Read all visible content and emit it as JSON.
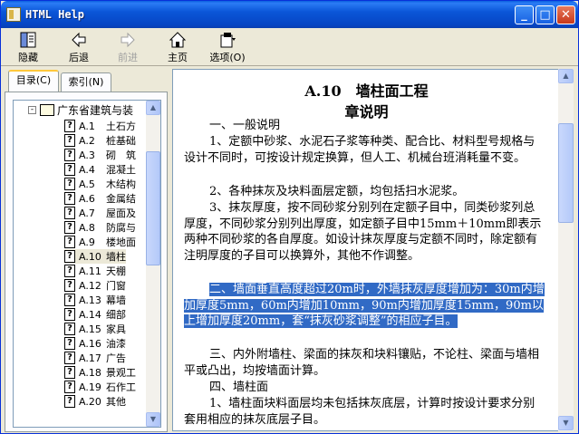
{
  "window": {
    "title": "HTML Help"
  },
  "titlebar_buttons": {
    "minimize": "_",
    "maximize": "□",
    "close": "✕"
  },
  "toolbar": {
    "hide": "隐藏",
    "back": "后退",
    "forward": "前进",
    "home": "主页",
    "options": "选项(O)"
  },
  "tabs": {
    "contents": "目录(C)",
    "index": "索引(N)"
  },
  "tree": {
    "root": "广东省建筑与装",
    "items": [
      {
        "code": "A.1",
        "label": "土石方"
      },
      {
        "code": "A.2",
        "label": "桩基础"
      },
      {
        "code": "A.3",
        "label": "砌　筑"
      },
      {
        "code": "A.4",
        "label": "混凝土"
      },
      {
        "code": "A.5",
        "label": "木结构"
      },
      {
        "code": "A.6",
        "label": "金属结"
      },
      {
        "code": "A.7",
        "label": "屋面及"
      },
      {
        "code": "A.8",
        "label": "防腐与"
      },
      {
        "code": "A.9",
        "label": "楼地面"
      },
      {
        "code": "A.10",
        "label": "墙柱"
      },
      {
        "code": "A.11",
        "label": "天棚"
      },
      {
        "code": "A.12",
        "label": "门窗"
      },
      {
        "code": "A.13",
        "label": "幕墙"
      },
      {
        "code": "A.14",
        "label": "细部"
      },
      {
        "code": "A.15",
        "label": "家具"
      },
      {
        "code": "A.16",
        "label": "油漆"
      },
      {
        "code": "A.17",
        "label": "广告"
      },
      {
        "code": "A.18",
        "label": "景观工"
      },
      {
        "code": "A.19",
        "label": "石作工"
      },
      {
        "code": "A.20",
        "label": "其他"
      }
    ]
  },
  "doc": {
    "title1": "A.10　墙柱面工程",
    "title2": "章说明",
    "p1": "一、一般说明",
    "p2": "1、定额中砂浆、水泥石子浆等种类、配合比、材料型号规格与设计不同时，可按设计规定换算，但人工、机械台班消耗量不变。",
    "p3": "2、各种抹灰及块料面层定额，均包括扫水泥浆。",
    "p4": "3、抹灰厚度，按不同砂浆分别列在定额子目中，同类砂浆列总厚度，不同砂浆分别列出厚度，如定额子目中15mm＋10mm即表示两种不同砂浆的各自厚度。如设计抹灰厚度与定额不同时，除定额有注明厚度的子目可以换算外，其他不作调整。",
    "p5": "二、墙面垂直高度超过20m时，外墙抹灰厚度增加为：30m内增加厚度5mm，60m内增加10mm，90m内增加厚度15mm，90m以上增加厚度20mm，套“抹灰砂浆调整”的相应子目。",
    "p6": "三、内外附墙柱、梁面的抹灰和块料镶贴，不论柱、梁面与墙相平或凸出，均按墙面计算。",
    "p7": "四、墙柱面",
    "p8": "1、墙柱面块料面层均未包括抹灰底层，计算时按设计要求分别套用相应的抹灰底层子目。"
  }
}
